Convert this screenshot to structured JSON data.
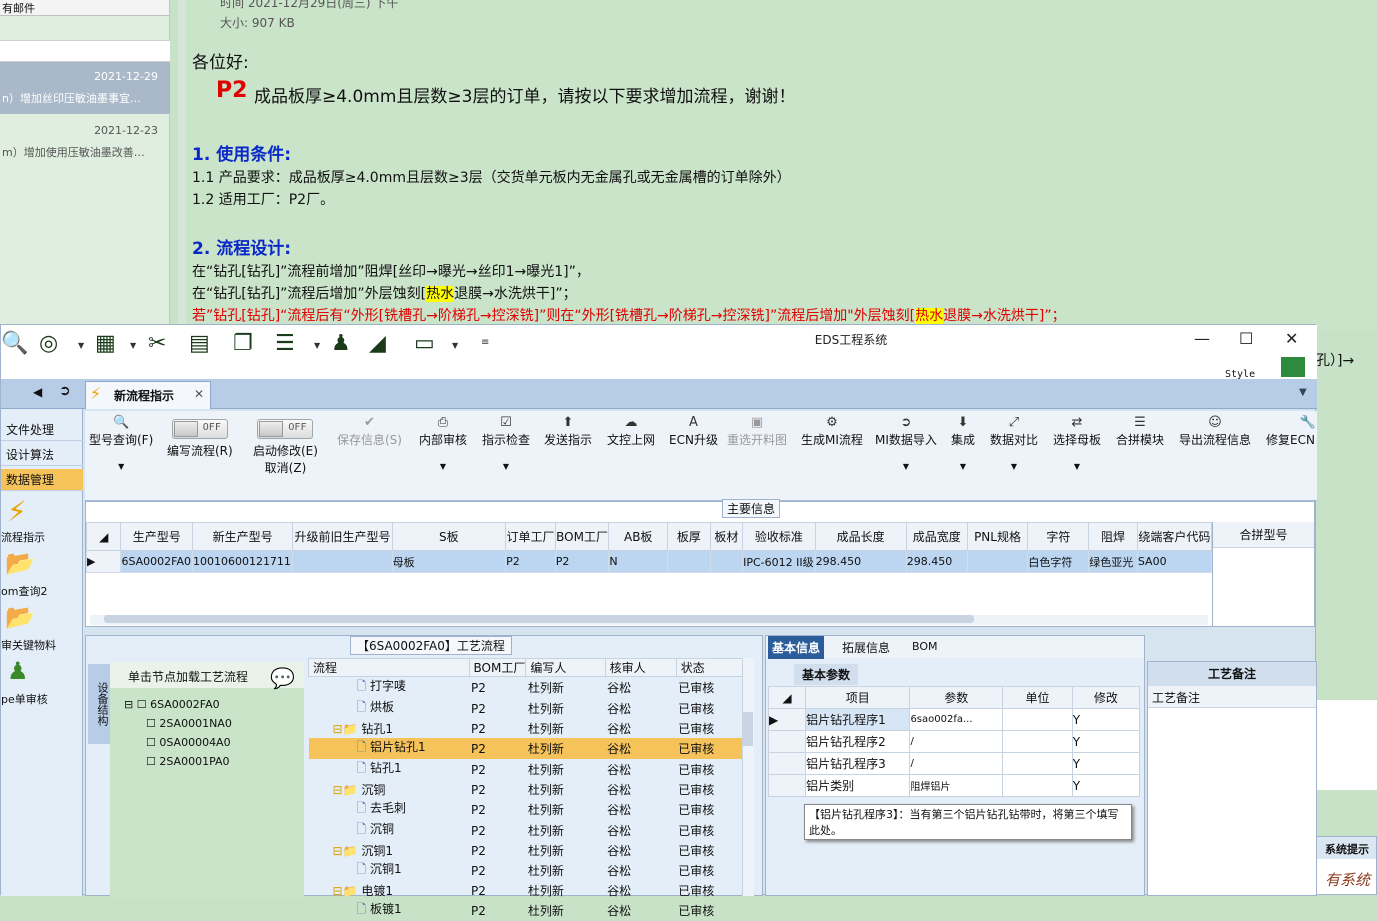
{
  "mail": {
    "list_header": "有邮件",
    "items": [
      {
        "date": "2021-12-29",
        "subject": "n）增加丝印压敏油墨事宜…"
      },
      {
        "date": "2021-12-23",
        "subject": "m）增加使用压敏油墨改善…"
      }
    ],
    "meta_time": "时间 2021-12月29日(周三) 下午",
    "meta_size": "大小: 907 KB",
    "greeting": "各位好:",
    "p2_tag": "P2",
    "headline": "成品板厚≥4.0mm且层数≥3层的订单，请按以下要求增加流程，谢谢！",
    "sec1_title": "1. 使用条件:",
    "sec1_l1": "1.1  产品要求：成品板厚≥4.0mm且层数≥3层（交货单元板内无金属孔或无金属槽的订单除外）",
    "sec1_l2": "1.2  适用工厂：P2厂。",
    "sec2_title": "2. 流程设计:",
    "sec2_l1": "在“钻孔[钻孔]”流程前增加”阻焊[丝印→曝光→丝印1→曝光1]”，",
    "sec2_l2a": "在“钻孔[钻孔]”流程后增加”外层蚀刻[",
    "sec2_l2hl": "热水",
    "sec2_l2b": "退膜→水洗烘干]”；",
    "sec2_l3a": "若”钻孔[钻孔]“流程后有“外形[铣槽孔→阶梯孔→控深铣]”则在“外形[铣槽孔→阶梯孔→控深铣]”流程后增加\"外层蚀刻[",
    "sec2_l3hl": "热水",
    "sec2_l3b": "退膜→水洗烘干]”；",
    "overflow_right": "孔）]→"
  },
  "eds": {
    "title": "EDS工程系统",
    "style_label": "Style",
    "tab_label": "新流程指示",
    "nav": [
      "文件处理",
      "设计算法",
      "数据管理"
    ],
    "nav_big": [
      "流程指示",
      "om查询2",
      "审关键物料",
      "pe单审核"
    ],
    "ribbon": {
      "query": "型号查询(F)",
      "edit_flow": "编写流程(R)",
      "toggle_off": "OFF",
      "start_modify": "启动修改(E)",
      "cancel": "取消(Z)",
      "save": "保存信息(S)",
      "internal_review": "内部审核",
      "check": "指示检查",
      "send": "发送指示",
      "doc_upload": "文控上网",
      "ecn_up": "ECN升级",
      "reselect": "重选开料图",
      "gen_mi": "生成MI流程",
      "mi_import": "MI数据导入",
      "integrate": "集成",
      "compare": "数据对比",
      "select_mother": "选择母板",
      "merge_module": "合拼模块",
      "export_flow": "导出流程信息",
      "fix_ecn": "修复ECN"
    },
    "main_info_label": "主要信息",
    "grid_headers": [
      "生产型号",
      "新生产型号",
      "升级前旧生产型号",
      "S板",
      "订单工厂",
      "BOM工厂",
      "AB板",
      "板厚",
      "板材",
      "验收标准",
      "成品长度",
      "成品宽度",
      "PNL规格",
      "字符",
      "阻焊",
      "绕端客户代码"
    ],
    "grid_row": [
      "6SA0002FA0",
      "10010600121711",
      "",
      "母板",
      "P2",
      "P2",
      "N",
      "",
      "",
      "IPC-6012 II级",
      "298.450",
      "298.450",
      "",
      "白色字符",
      "绿色亚光",
      "SA00"
    ],
    "merge_header": "合拼型号",
    "proc_title": "【6SA0002FA0】工艺流程",
    "side_tab": "设备结构",
    "tree_hint": "单击节点加载工艺流程",
    "tree": [
      "6SA0002FA0",
      "2SA0001NA0",
      "0SA00004A0",
      "2SA0001PA0"
    ],
    "flow_headers": [
      "流程",
      "BOM工厂",
      "编写人",
      "核审人",
      "状态"
    ],
    "flow_rows": [
      {
        "name": "打字唛",
        "level": 2,
        "bom": "P2",
        "author": "杜列新",
        "rev": "谷松",
        "status": "已审核"
      },
      {
        "name": "烘板",
        "level": 2,
        "bom": "P2",
        "author": "杜列新",
        "rev": "谷松",
        "status": "已审核"
      },
      {
        "name": "钻孔1",
        "level": 1,
        "bom": "P2",
        "author": "杜列新",
        "rev": "谷松",
        "status": "已审核"
      },
      {
        "name": "铝片钻孔1",
        "level": 2,
        "bom": "P2",
        "author": "杜列新",
        "rev": "谷松",
        "status": "已审核",
        "selected": true
      },
      {
        "name": "钻孔1",
        "level": 2,
        "bom": "P2",
        "author": "杜列新",
        "rev": "谷松",
        "status": "已审核"
      },
      {
        "name": "沉铜",
        "level": 1,
        "bom": "P2",
        "author": "杜列新",
        "rev": "谷松",
        "status": "已审核"
      },
      {
        "name": "去毛刺",
        "level": 2,
        "bom": "P2",
        "author": "杜列新",
        "rev": "谷松",
        "status": "已审核"
      },
      {
        "name": "沉铜",
        "level": 2,
        "bom": "P2",
        "author": "杜列新",
        "rev": "谷松",
        "status": "已审核"
      },
      {
        "name": "沉铜1",
        "level": 1,
        "bom": "P2",
        "author": "杜列新",
        "rev": "谷松",
        "status": "已审核"
      },
      {
        "name": "沉铜1",
        "level": 2,
        "bom": "P2",
        "author": "杜列新",
        "rev": "谷松",
        "status": "已审核"
      },
      {
        "name": "电镀1",
        "level": 1,
        "bom": "P2",
        "author": "杜列新",
        "rev": "谷松",
        "status": "已审核"
      },
      {
        "name": "板镀1",
        "level": 2,
        "bom": "P2",
        "author": "杜列新",
        "rev": "谷松",
        "status": "已审核"
      }
    ],
    "right_tabs": [
      "基本信息",
      "拓展信息",
      "BOM"
    ],
    "basic_params": "基本参数",
    "param_headers": [
      "项目",
      "参数",
      "单位",
      "修改"
    ],
    "params": [
      {
        "item": "铝片钻孔程序1",
        "value": "6sao002fa...",
        "unit": "",
        "mod": "Y"
      },
      {
        "item": "铝片钻孔程序2",
        "value": "/",
        "unit": "",
        "mod": "Y"
      },
      {
        "item": "铝片钻孔程序3",
        "value": "/",
        "unit": "",
        "mod": "Y"
      },
      {
        "item": "铝片类别",
        "value": "阻焊铝片",
        "unit": "",
        "mod": "Y"
      }
    ],
    "tooltip": "【铝片钻孔程序3】：当有第三个铝片钻孔钻带时，将第三个填写此处。",
    "remark_tab": "工艺备注",
    "remark_label": "工艺备注",
    "sys_popup": "系统提示",
    "sys_popup_body": "有系统"
  }
}
